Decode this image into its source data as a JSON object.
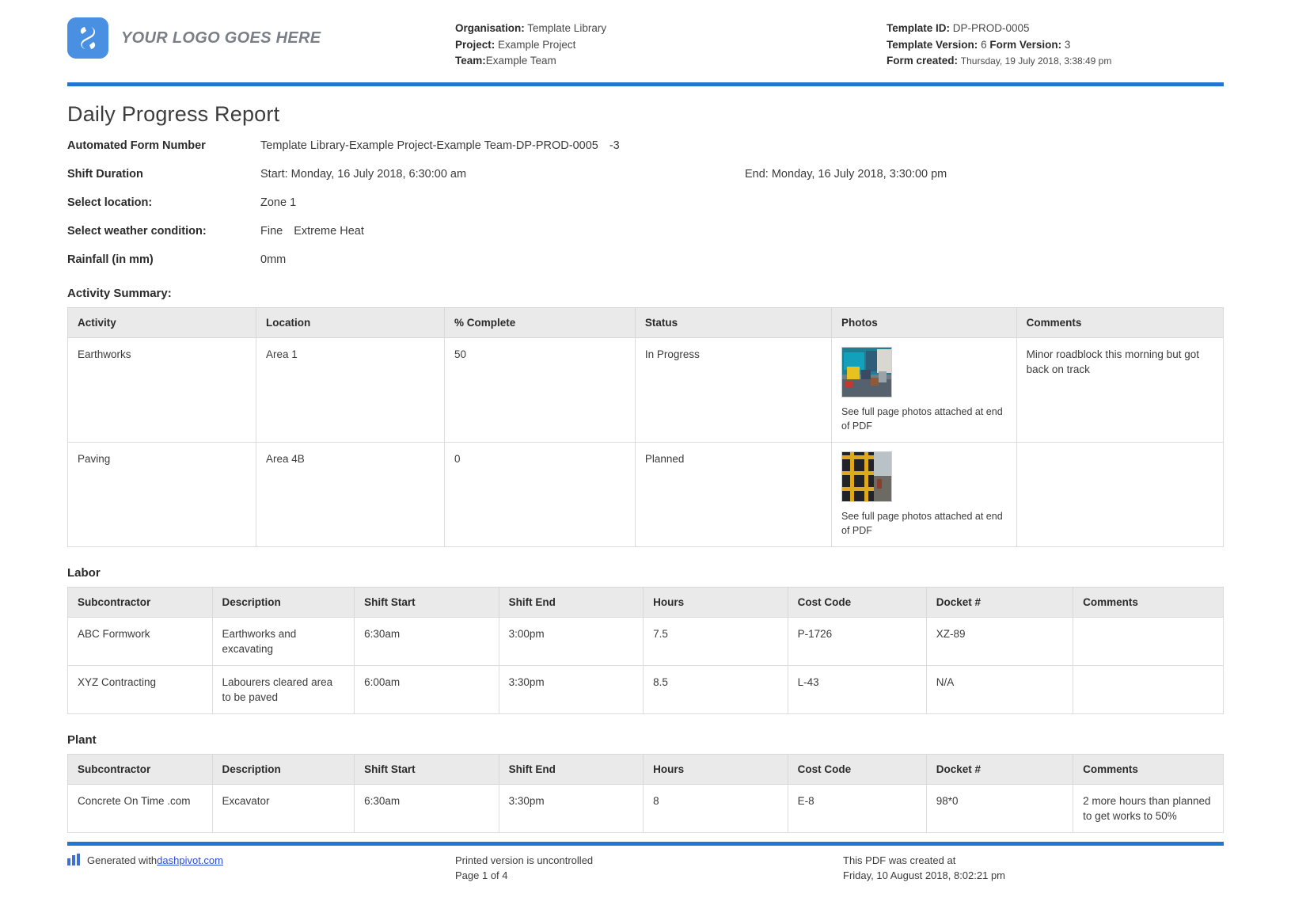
{
  "header": {
    "logo_text": "YOUR LOGO GOES HERE",
    "left_meta": [
      {
        "label": "Organisation:",
        "value": "Template Library"
      },
      {
        "label": "Project:",
        "value": "Example Project"
      },
      {
        "label": "Team:",
        "value": "Example Team"
      }
    ],
    "right_meta": [
      {
        "label": "Template ID:",
        "value": "DP-PROD-0005"
      },
      {
        "label": "Template Version:",
        "value": "6",
        "label2": "Form Version:",
        "value2": "3"
      },
      {
        "label": "Form created:",
        "value": "Thursday, 19 July 2018, 3:38:49 pm"
      }
    ],
    "accent_color": "#2176d2",
    "logo_color": "#4a90e2"
  },
  "title": "Daily Progress Report",
  "fields": {
    "automated_form_number_label": "Automated Form Number",
    "automated_form_number_value": "Template Library-Example Project-Example Team-DP-PROD-0005",
    "automated_form_number_suffix": "-3",
    "shift_duration_label": "Shift Duration",
    "shift_start": "Start: Monday, 16 July 2018, 6:30:00 am",
    "shift_end": "End: Monday, 16 July 2018, 3:30:00 pm",
    "location_label": "Select location:",
    "location_value": "Zone 1",
    "weather_label": "Select weather condition:",
    "weather_value_1": "Fine",
    "weather_value_2": "Extreme Heat",
    "rainfall_label": "Rainfall (in mm)",
    "rainfall_value": "0mm"
  },
  "activity_summary": {
    "heading": "Activity Summary:",
    "columns": [
      "Activity",
      "Location",
      "% Complete",
      "Status",
      "Photos",
      "Comments"
    ],
    "rows": [
      {
        "activity": "Earthworks",
        "location": "Area 1",
        "percent_complete": "50",
        "status": "In Progress",
        "photo_note": "See full page photos attached at end of PDF",
        "comments": "Minor roadblock this morning but got back on track"
      },
      {
        "activity": "Paving",
        "location": "Area 4B",
        "percent_complete": "0",
        "status": "Planned",
        "photo_note": "See full page photos attached at end of PDF",
        "comments": ""
      }
    ]
  },
  "labor": {
    "heading": "Labor",
    "columns": [
      "Subcontractor",
      "Description",
      "Shift Start",
      "Shift End",
      "Hours",
      "Cost Code",
      "Docket #",
      "Comments"
    ],
    "rows": [
      {
        "subcontractor": "ABC Formwork",
        "description": "Earthworks and excavating",
        "shift_start": "6:30am",
        "shift_end": "3:00pm",
        "hours": "7.5",
        "cost_code": "P-1726",
        "docket": "XZ-89",
        "comments": ""
      },
      {
        "subcontractor": "XYZ Contracting",
        "description": "Labourers cleared area to be paved",
        "shift_start": "6:00am",
        "shift_end": "3:30pm",
        "hours": "8.5",
        "cost_code": "L-43",
        "docket": "N/A",
        "comments": ""
      }
    ]
  },
  "plant": {
    "heading": "Plant",
    "columns": [
      "Subcontractor",
      "Description",
      "Shift Start",
      "Shift End",
      "Hours",
      "Cost Code",
      "Docket #",
      "Comments"
    ],
    "rows": [
      {
        "subcontractor": "Concrete On Time .com",
        "description": "Excavator",
        "shift_start": "6:30am",
        "shift_end": "3:30pm",
        "hours": "8",
        "cost_code": "E-8",
        "docket": "98*0",
        "comments": "2 more hours than planned to get works to 50%"
      }
    ]
  },
  "footer": {
    "generated_prefix": "Generated with ",
    "generated_link": "dashpivot.com",
    "printed_notice": "Printed version is uncontrolled",
    "page_number": "Page 1 of 4",
    "created_notice": "This PDF was created at",
    "created_date": "Friday, 10 August 2018, 8:02:21 pm"
  }
}
